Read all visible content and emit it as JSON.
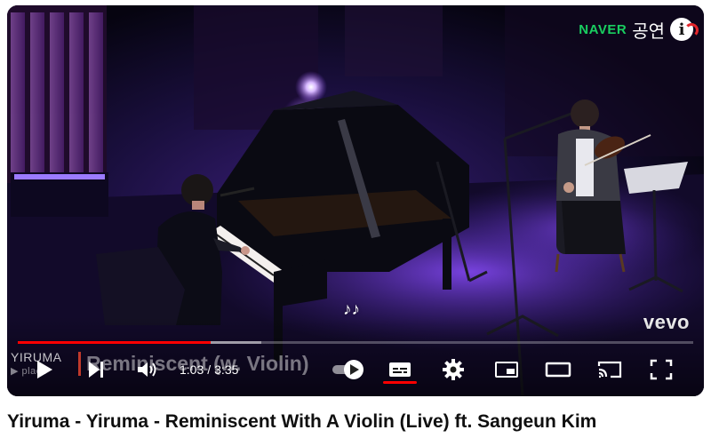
{
  "player": {
    "naver_brand": "NAVER",
    "naver_korean": "공연",
    "naver_info_glyph": "i",
    "vevo_logo": "vevo",
    "music_notes": "♪♪",
    "channel_watermark_line1": "YIRUMA",
    "channel_watermark_line2": "▶ place",
    "overlay_title": "Reminiscent (w. Violin)",
    "progress_played_fraction": 0.286,
    "progress_buffered_fraction": 0.36,
    "progress_color": "#ff0000",
    "time_current": "1:03",
    "time_separator": "/",
    "time_total": "3:35",
    "icons": {
      "play": "play-icon",
      "next": "skip-next-icon",
      "volume": "volume-icon",
      "autoplay": "autoplay-toggle-icon",
      "captions": "captions-icon",
      "settings": "settings-gear-icon",
      "miniplayer": "miniplayer-icon",
      "theater": "theater-mode-icon",
      "cast": "cast-icon",
      "fullscreen": "fullscreen-icon"
    }
  },
  "video": {
    "title": "Yiruma - Yiruma - Reminiscent With A Violin (Live) ft. Sangeun Kim"
  }
}
